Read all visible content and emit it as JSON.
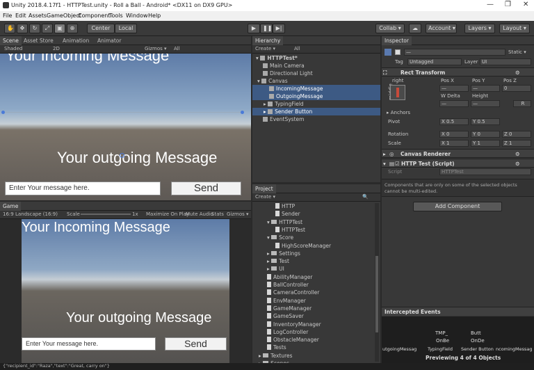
{
  "window": {
    "title": "Unity 2018.4.17f1 - HTTPTest.unity - Roll a Ball - Android* <DX11 on DX9 GPU>"
  },
  "menu": [
    "File",
    "Edit",
    "Assets",
    "GameObject",
    "Component",
    "Tools",
    "Window",
    "Help"
  ],
  "toolbar": {
    "pivot_label": "Center",
    "space_label": "Local",
    "collab_label": "Collab ▾",
    "account_label": "Account ▾",
    "layers_label": "Layers ▾",
    "layout_label": "Layout ▾"
  },
  "scene_tabs": {
    "scene": "Scene",
    "asset_store": "Asset Store",
    "animation": "Animation",
    "animator": "Animator"
  },
  "scene_toolbar": {
    "shading": "Shaded",
    "mode_2d": "2D",
    "gizmos": "Gizmos ▾",
    "search": "All"
  },
  "scene_view": {
    "incoming": "Your Incoming Message",
    "outgoing": "Your outgoing Message",
    "input_placeholder": "Enter Your message here.",
    "send": "Send"
  },
  "game_tab": {
    "label": "Game",
    "aspect": "16:9 Landscape (16:9)",
    "scale_label": "Scale",
    "scale_value": "1x",
    "maximize": "Maximize On Play",
    "mute": "Mute Audio",
    "stats": "Stats",
    "gizmos": "Gizmos ▾"
  },
  "game_view": {
    "incoming": "Your Incoming Message",
    "outgoing": "Your outgoing Message",
    "input_placeholder": "Enter Your message here.",
    "send": "Send"
  },
  "hierarchy": {
    "tab": "Hierarchy",
    "create": "Create ▾",
    "search": "All",
    "items": [
      {
        "label": "HTTPTest*",
        "depth": 0
      },
      {
        "label": "Main Camera",
        "depth": 1
      },
      {
        "label": "Directional Light",
        "depth": 1
      },
      {
        "label": "Canvas",
        "depth": 1
      },
      {
        "label": "IncomingMessage",
        "depth": 2
      },
      {
        "label": "OutgoingMessage",
        "depth": 2
      },
      {
        "label": "TypingField",
        "depth": 2
      },
      {
        "label": "Sender Button",
        "depth": 2
      },
      {
        "label": "EventSystem",
        "depth": 1
      }
    ]
  },
  "project": {
    "tab": "Project",
    "create": "Create ▾",
    "items": [
      {
        "label": "HTTP",
        "kind": "file",
        "depth": 3
      },
      {
        "label": "Sender",
        "kind": "file",
        "depth": 3
      },
      {
        "label": "HTTPTest",
        "kind": "folder",
        "depth": 2
      },
      {
        "label": "HTTPTest",
        "kind": "file",
        "depth": 3
      },
      {
        "label": "Score",
        "kind": "folder",
        "depth": 2
      },
      {
        "label": "HighScoreManager",
        "kind": "file",
        "depth": 3
      },
      {
        "label": "Settings",
        "kind": "folder",
        "depth": 2
      },
      {
        "label": "Test",
        "kind": "folder",
        "depth": 2
      },
      {
        "label": "UI",
        "kind": "folder",
        "depth": 2
      },
      {
        "label": "AbilityManager",
        "kind": "file",
        "depth": 2
      },
      {
        "label": "BallController",
        "kind": "file",
        "depth": 2
      },
      {
        "label": "CameraController",
        "kind": "file",
        "depth": 2
      },
      {
        "label": "EnvManager",
        "kind": "file",
        "depth": 2
      },
      {
        "label": "GameManager",
        "kind": "file",
        "depth": 2
      },
      {
        "label": "GameSaver",
        "kind": "file",
        "depth": 2
      },
      {
        "label": "InventoryManager",
        "kind": "file",
        "depth": 2
      },
      {
        "label": "LogController",
        "kind": "file",
        "depth": 2
      },
      {
        "label": "ObstacleManager",
        "kind": "file",
        "depth": 2
      },
      {
        "label": "Tests",
        "kind": "file",
        "depth": 2
      },
      {
        "label": "Textures",
        "kind": "folder",
        "depth": 1
      },
      {
        "label": "Scenes",
        "kind": "folder",
        "depth": 1
      }
    ]
  },
  "inspector": {
    "tab": "Inspector",
    "name_value": "—",
    "static_label": "Static ▾",
    "tag_label": "Tag",
    "tag_value": "Untagged",
    "layer_label": "Layer",
    "layer_value": "UI",
    "rect_transform": "Rect Transform",
    "anchor_h": "right",
    "anchor_v": "middle",
    "pos_x_label": "Pos X",
    "pos_y_label": "Pos Y",
    "pos_z_label": "Pos Z",
    "pos_x": "—",
    "pos_y": "—",
    "pos_z": "0",
    "w_delta_label": "W Delta",
    "height_label": "Height",
    "w_delta": "—",
    "height": "—",
    "r_btn": "R",
    "anchors_label": "Anchors",
    "pivot_label": "Pivot",
    "pivot_x": "X 0.5",
    "pivot_y": "Y 0.5",
    "rotation_label": "Rotation",
    "rot_x": "X 0",
    "rot_y": "Y 0",
    "rot_z": "Z 0",
    "scale_label": "Scale",
    "scale_x": "X 1",
    "scale_y": "Y 1",
    "scale_z": "Z 1",
    "canvas_renderer": "Canvas Renderer",
    "http_test": "HTTP Test (Script)",
    "script_label": "Script",
    "script_value": "HTTPTest",
    "multi_note": "Components that are only on some of the selected objects cannot be multi-edited.",
    "add_component": "Add Component"
  },
  "intercepted": {
    "header": "Intercepted Events",
    "row1": [
      "TMP_",
      "Butt"
    ],
    "row2": [
      "OnBe",
      "OnDe"
    ],
    "row3": [
      "utgoingMessag",
      "TypingField",
      "Sender Button",
      "ncomingMessag"
    ],
    "footer": "Previewing 4 of 4 Objects"
  },
  "status_bar": "{\"recipient_id\":\"Raza\",\"text\":\"Great, carry on\"}"
}
